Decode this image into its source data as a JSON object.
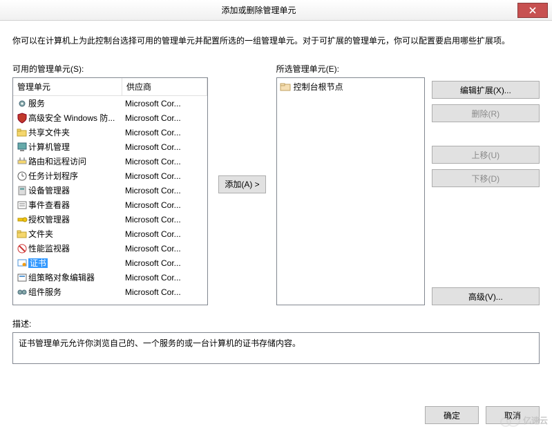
{
  "title": "添加或删除管理单元",
  "instruction": "你可以在计算机上为此控制台选择可用的管理单元并配置所选的一组管理单元。对于可扩展的管理单元，你可以配置要启用哪些扩展项。",
  "available_label": "可用的管理单元(S):",
  "selected_label": "所选管理单元(E):",
  "header_name": "管理单元",
  "header_vendor": "供应商",
  "snapins": [
    {
      "name": "服务",
      "vendor": "Microsoft Cor...",
      "icon": "gear"
    },
    {
      "name": "高级安全 Windows 防...",
      "vendor": "Microsoft Cor...",
      "icon": "shield"
    },
    {
      "name": "共享文件夹",
      "vendor": "Microsoft Cor...",
      "icon": "folder-share"
    },
    {
      "name": "计算机管理",
      "vendor": "Microsoft Cor...",
      "icon": "computer"
    },
    {
      "name": "路由和远程访问",
      "vendor": "Microsoft Cor...",
      "icon": "router"
    },
    {
      "name": "任务计划程序",
      "vendor": "Microsoft Cor...",
      "icon": "clock"
    },
    {
      "name": "设备管理器",
      "vendor": "Microsoft Cor...",
      "icon": "device"
    },
    {
      "name": "事件查看器",
      "vendor": "Microsoft Cor...",
      "icon": "event"
    },
    {
      "name": "授权管理器",
      "vendor": "Microsoft Cor...",
      "icon": "key"
    },
    {
      "name": "文件夹",
      "vendor": "Microsoft Cor...",
      "icon": "folder"
    },
    {
      "name": "性能监视器",
      "vendor": "Microsoft Cor...",
      "icon": "perf"
    },
    {
      "name": "证书",
      "vendor": "Microsoft Cor...",
      "icon": "cert",
      "selected": true
    },
    {
      "name": "组策略对象编辑器",
      "vendor": "Microsoft Cor...",
      "icon": "gpo"
    },
    {
      "name": "组件服务",
      "vendor": "Microsoft Cor...",
      "icon": "comp-svc"
    }
  ],
  "selected_tree_root": "控制台根节点",
  "buttons": {
    "add": "添加(A) >",
    "edit_ext": "编辑扩展(X)...",
    "remove": "删除(R)",
    "move_up": "上移(U)",
    "move_down": "下移(D)",
    "advanced": "高级(V)...",
    "ok": "确定",
    "cancel": "取消"
  },
  "description_label": "描述:",
  "description_text": "证书管理单元允许你浏览自己的、一个服务的或一台计算机的证书存储内容。",
  "watermark": "亿速云"
}
